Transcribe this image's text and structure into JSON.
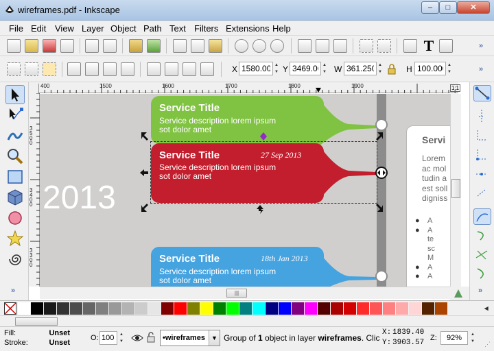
{
  "window": {
    "title": "wireframes.pdf - Inkscape",
    "minimize": "‒",
    "maximize": "□",
    "close": "✕"
  },
  "menu": [
    "File",
    "Edit",
    "View",
    "Layer",
    "Object",
    "Path",
    "Text",
    "Filters",
    "Extensions",
    "Help"
  ],
  "toolbar1": {
    "icons": [
      "new-document-icon",
      "open-icon",
      "save-icon",
      "print-icon",
      "import-icon",
      "export-icon",
      "undo-icon",
      "redo-icon",
      "copy-icon",
      "cut-icon",
      "paste-icon",
      "zoom-selection-icon",
      "zoom-drawing-icon",
      "zoom-page-icon",
      "duplicate-icon",
      "clone-icon",
      "unlink-clone-icon",
      "group-icon",
      "ungroup-icon",
      "fill-stroke-icon",
      "text-font-icon",
      "layers-icon"
    ],
    "overflow": "»"
  },
  "toolbar2": {
    "x_label": "X",
    "x_value": "1580.00",
    "y_label": "Y",
    "y_value": "3469.06",
    "w_label": "W",
    "w_value": "361.250",
    "h_label": "H",
    "h_value": "100.000",
    "overflow": "»"
  },
  "rulers": {
    "h_ticks": [
      "400",
      "1500",
      "1600",
      "1700",
      "1800",
      "1900"
    ],
    "v_ticks": [
      "3500",
      "3400",
      "3300"
    ]
  },
  "canvas": {
    "year": "2013",
    "cards": [
      {
        "title": "Service Title",
        "desc_1": "Service description lorem ipsum",
        "desc_2": "sot dolor amet",
        "date": "",
        "color": "#80c242"
      },
      {
        "title": "Service Title",
        "desc_1": "Service description lorem ipsum",
        "desc_2": "sot dolor amet",
        "date": "27 Sep 2013",
        "color": "#c21e2d"
      },
      {
        "title": "Service Title",
        "desc_1": "Service description lorem ipsum",
        "desc_2": "sot dolor amet",
        "date": "18th Jan 2013",
        "color": "#45a3e0"
      }
    ],
    "side_panel": {
      "heading": "Servi",
      "lines": [
        "Lorem",
        "ac mol",
        "tudin a",
        "est soll",
        "digniss"
      ],
      "bullets": [
        "A",
        "A",
        "te",
        "sc",
        "M",
        "A",
        "A"
      ]
    }
  },
  "palette": [
    "#ffffff",
    "#000000",
    "#1a1a1a",
    "#333333",
    "#4d4d4d",
    "#666666",
    "#808080",
    "#999999",
    "#b3b3b3",
    "#cccccc",
    "#e6e6e6",
    "#800000",
    "#ff0000",
    "#808000",
    "#ffff00",
    "#008000",
    "#00ff00",
    "#008080",
    "#00ffff",
    "#000080",
    "#0000ff",
    "#800080",
    "#ff00ff",
    "#550000",
    "#aa0000",
    "#d40000",
    "#ff2a2a",
    "#ff5555",
    "#ff8080",
    "#ffaaaa",
    "#ffd5d5",
    "#552200",
    "#aa4400"
  ],
  "status": {
    "fill_label": "Fill:",
    "fill_value": "Unset",
    "stroke_label": "Stroke:",
    "stroke_value": "Unset",
    "opacity_label": "O:",
    "opacity_value": "100",
    "layer": "•wireframes",
    "message_pre": "Group of ",
    "message_count": "1",
    "message_mid": " object in layer ",
    "message_layer": "wireframes",
    "message_post": ". Clic",
    "x_label": "X:",
    "x_value": "1839.40",
    "y_label": "Y:",
    "y_value": "3903.57",
    "zoom_label": "Z:",
    "zoom_value": "92%"
  }
}
